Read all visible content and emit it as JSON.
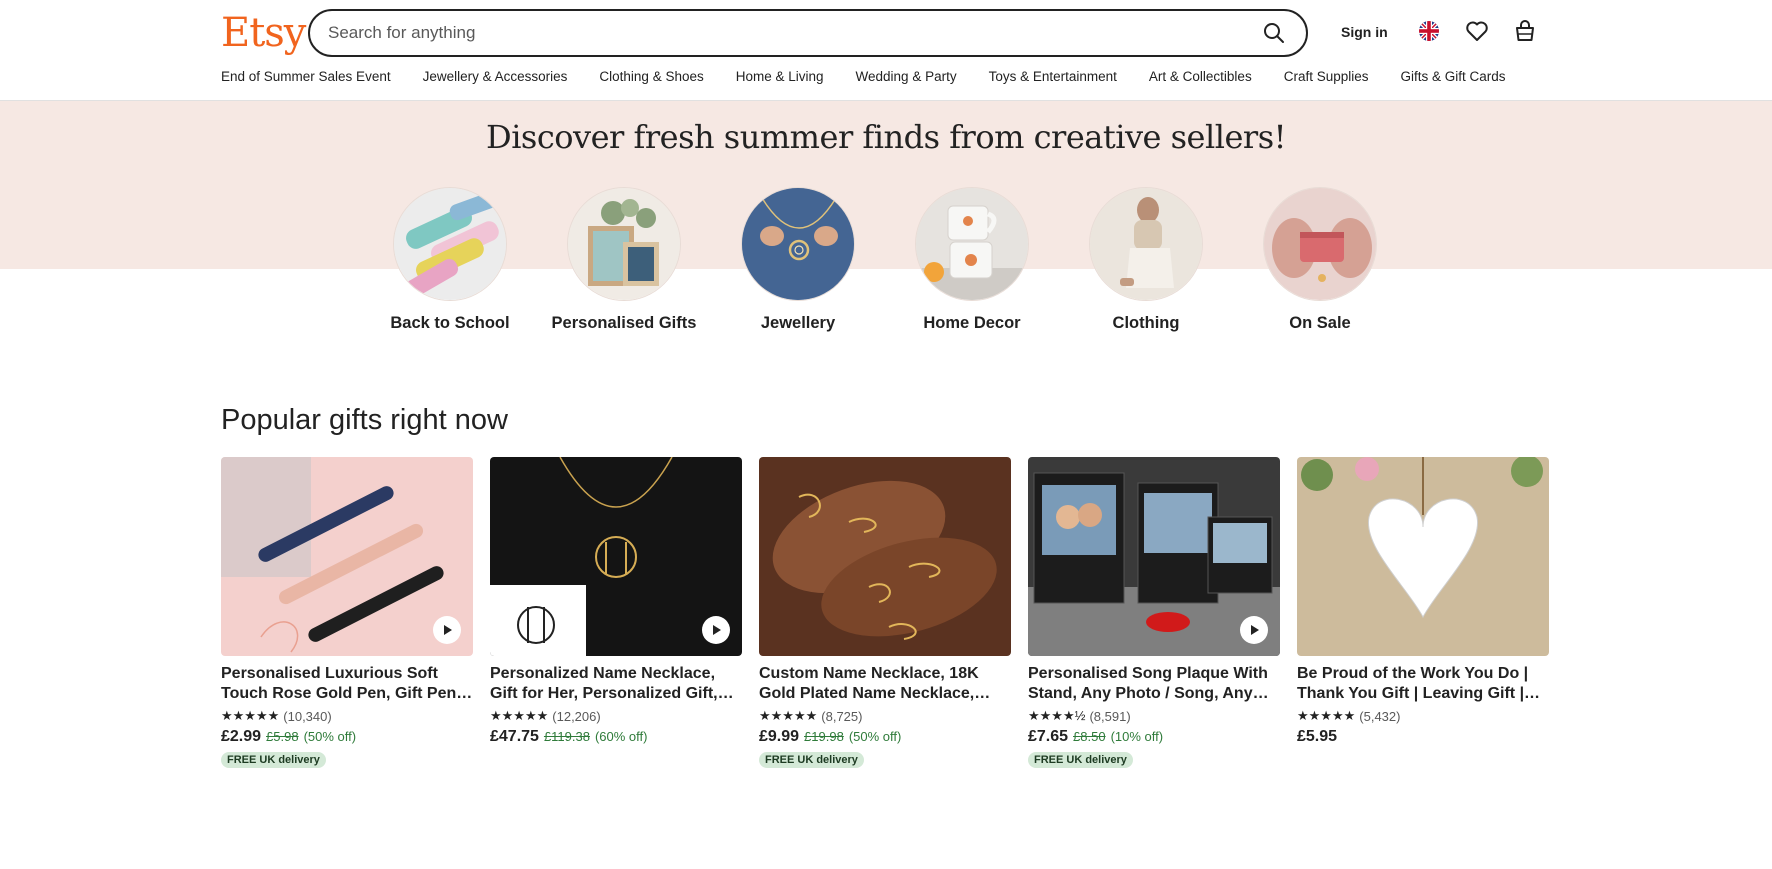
{
  "header": {
    "logo": "Etsy",
    "search_placeholder": "Search for anything",
    "sign_in": "Sign in",
    "nav": [
      "End of Summer Sales Event",
      "Jewellery & Accessories",
      "Clothing & Shoes",
      "Home & Living",
      "Wedding & Party",
      "Toys & Entertainment",
      "Art & Collectibles",
      "Craft Supplies",
      "Gifts & Gift Cards"
    ]
  },
  "hero": {
    "title": "Discover fresh summer finds from creative sellers!",
    "categories": [
      {
        "label": "Back to School"
      },
      {
        "label": "Personalised Gifts"
      },
      {
        "label": "Jewellery"
      },
      {
        "label": "Home Decor"
      },
      {
        "label": "Clothing"
      },
      {
        "label": "On Sale"
      }
    ]
  },
  "popular": {
    "title": "Popular gifts right now",
    "items": [
      {
        "title": "Personalised Luxurious Soft Touch Rose Gold Pen, Gift Pen…",
        "stars": "★★★★★",
        "reviews": "(10,340)",
        "price": "£2.99",
        "old_price": "£5.98",
        "discount": "(50% off)",
        "badge": "FREE UK delivery",
        "video": true
      },
      {
        "title": "Personalized Name Necklace, Gift for Her, Personalized Gift,…",
        "stars": "★★★★★",
        "reviews": "(12,206)",
        "price": "£47.75",
        "old_price": "£119.38",
        "discount": "(60% off)",
        "badge": "",
        "video": true
      },
      {
        "title": "Custom Name Necklace, 18K Gold Plated Name Necklace,…",
        "stars": "★★★★★",
        "reviews": "(8,725)",
        "price": "£9.99",
        "old_price": "£19.98",
        "discount": "(50% off)",
        "badge": "FREE UK delivery",
        "video": false
      },
      {
        "title": "Personalised Song Plaque With Stand, Any Photo / Song, Any…",
        "stars": "★★★★½",
        "reviews": "(8,591)",
        "price": "£7.65",
        "old_price": "£8.50",
        "discount": "(10% off)",
        "badge": "FREE UK delivery",
        "video": true
      },
      {
        "title": "Be Proud of the Work You Do | Thank You Gift | Leaving Gift |…",
        "stars": "★★★★★",
        "reviews": "(5,432)",
        "price": "£5.95",
        "old_price": "",
        "discount": "",
        "badge": "",
        "video": false
      }
    ]
  },
  "colors": {
    "brand": "#f1641e",
    "hero_band": "#f6e8e3",
    "sale_green": "#2f7b3a",
    "badge_bg": "#d4e9d7"
  }
}
